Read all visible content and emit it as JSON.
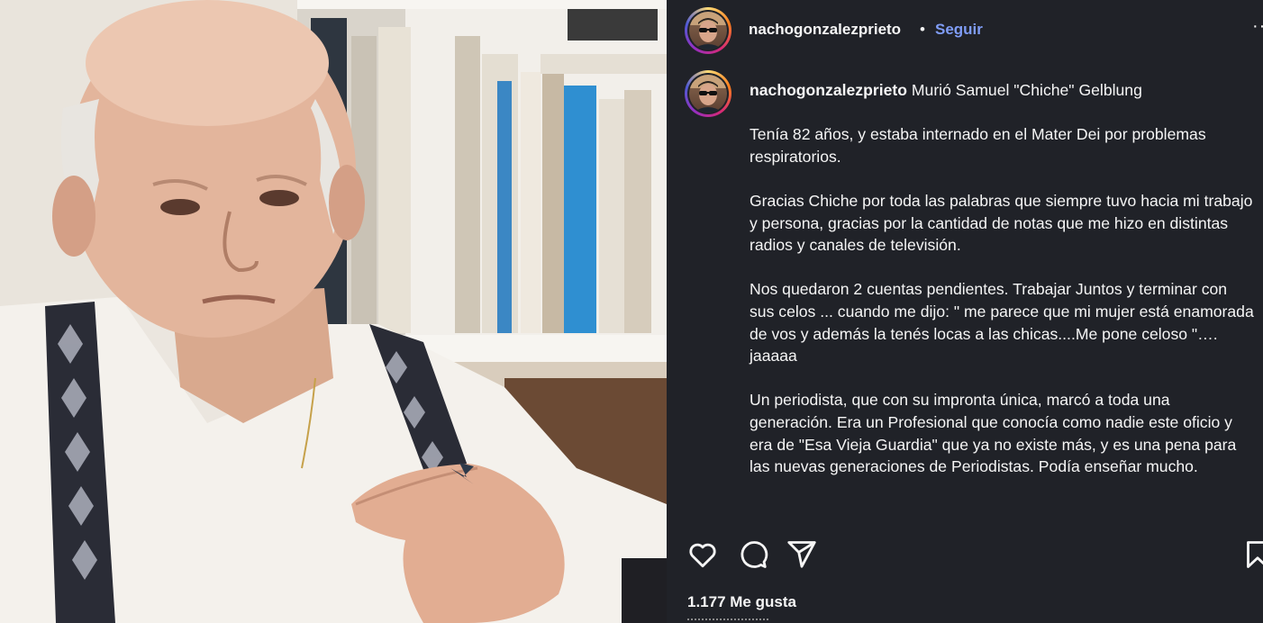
{
  "post": {
    "username": "nachogonzalezprieto",
    "separator": "•",
    "follow_label": "Seguir",
    "more_label": "···",
    "caption_title": "Murió Samuel \"Chiche\" Gelblung",
    "paragraphs": [
      "Tenía 82 años, y estaba internado en el Mater Dei por problemas respiratorios.",
      "Gracias Chiche por toda las palabras que siempre tuvo hacia mi trabajo y persona, gracias por la cantidad de notas que me hizo en distintas radios y canales de televisión.",
      "Nos quedaron 2 cuentas pendientes. Trabajar Juntos y terminar con sus celos ... cuando me dijo: \" me parece que mi mujer está enamorada de vos y además la tenés locas a las chicas....Me pone celoso \"…. jaaaaa",
      "Un periodista, que con su impronta única, marcó a toda una generación. Era un Profesional que conocía como nadie este oficio y era de \"Esa Vieja Guardia\" que ya no existe más, y es una pena para las nuevas generaciones de Periodistas. Podía enseñar mucho."
    ],
    "likes_label": "1.177 Me gusta"
  },
  "icons": {
    "like": "heart-icon",
    "comment": "comment-icon",
    "share": "send-icon",
    "save": "bookmark-icon"
  },
  "colors": {
    "panel_bg": "#202228",
    "follow": "#7f9cf5",
    "text": "#f5f5f5"
  }
}
